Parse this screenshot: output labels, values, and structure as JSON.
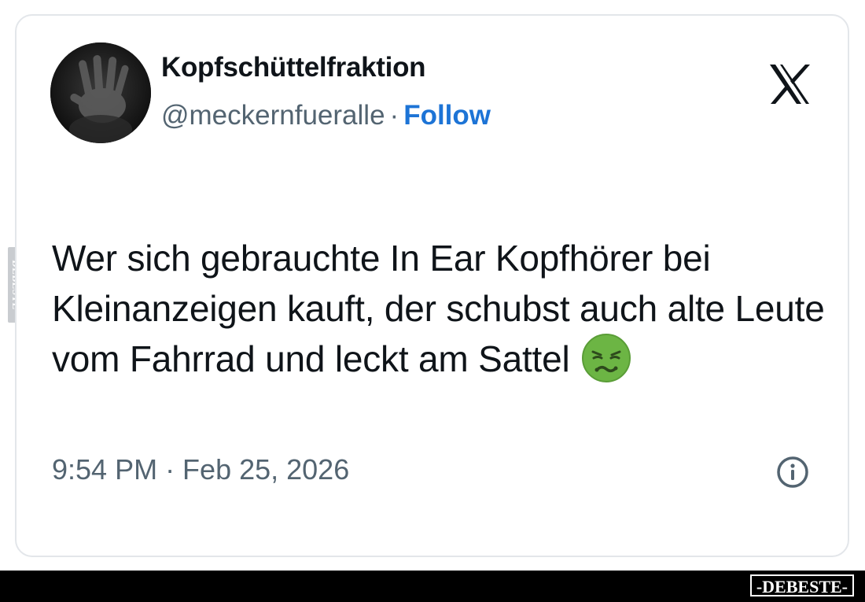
{
  "author": {
    "display_name": "Kopfschüttelfraktion",
    "handle": "@meckernfueralle",
    "separator": "·",
    "follow_label": "Follow",
    "avatar_icon": "hand-avatar"
  },
  "platform": {
    "logo_icon": "x-logo-icon"
  },
  "tweet": {
    "text": "Wer sich gebrauchte In Ear Kopfhörer bei Kleinanzeigen kauft, der schubst auch alte Leute vom Fahrrad und leckt am Sattel",
    "emoji_icon": "nauseated-face-emoji",
    "timestamp": "9:54 PM · Feb 25, 2026",
    "info_icon": "info-icon"
  },
  "watermark": {
    "brand": "-DEBESTE-",
    "side": "DEBESTE"
  },
  "colors": {
    "follow": "#1d74d6",
    "text": "#0f1419",
    "muted": "#536471",
    "emoji_green": "#6cb544",
    "footer": "#000000"
  }
}
